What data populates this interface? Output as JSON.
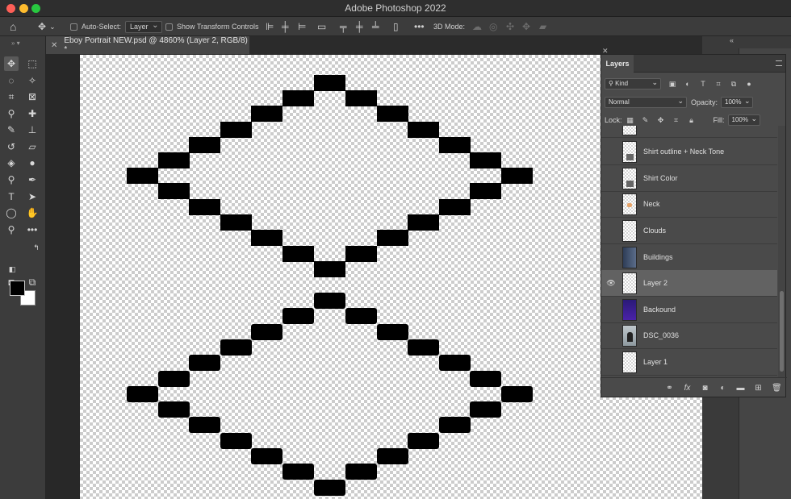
{
  "app": {
    "title": "Adobe Photoshop 2022"
  },
  "options_bar": {
    "auto_select_label": "Auto-Select:",
    "auto_select_value": "Layer",
    "show_transform_label": "Show Transform Controls",
    "mode_3d_label": "3D Mode:",
    "more": "•••"
  },
  "document_tab": {
    "title": "Eboy Portrait NEW.psd @ 4860% (Layer 2, RGB/8) *"
  },
  "colors": {
    "foreground": "#000000",
    "background": "#ffffff",
    "accent_selected": "#626262"
  },
  "layers_panel": {
    "tab_label": "Layers",
    "filter_kind": "Kind",
    "blend_mode": "Normal",
    "opacity_label": "Opacity:",
    "opacity_value": "100%",
    "lock_label": "Lock:",
    "fill_label": "Fill:",
    "fill_value": "100%",
    "layers": [
      {
        "name": "Shirt outline + Neck Tone",
        "visible": false,
        "selected": false
      },
      {
        "name": "Shirt Color",
        "visible": false,
        "selected": false
      },
      {
        "name": "Neck",
        "visible": false,
        "selected": false
      },
      {
        "name": "Clouds",
        "visible": false,
        "selected": false
      },
      {
        "name": "Buildings",
        "visible": false,
        "selected": false
      },
      {
        "name": "Layer 2",
        "visible": true,
        "selected": true
      },
      {
        "name": "Backound",
        "visible": false,
        "selected": false
      },
      {
        "name": "DSC_0036",
        "visible": false,
        "selected": false
      },
      {
        "name": "Layer 1",
        "visible": false,
        "selected": false
      }
    ],
    "footer_fx": "fx"
  }
}
